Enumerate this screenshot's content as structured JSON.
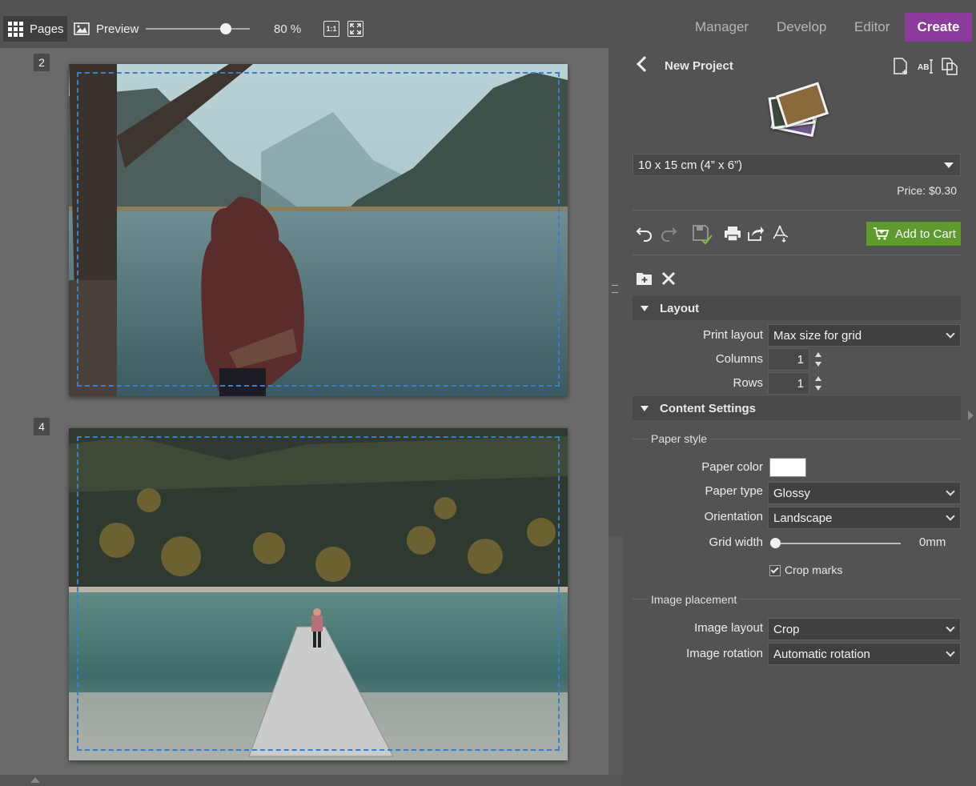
{
  "toolbar": {
    "pages_label": "Pages",
    "preview_label": "Preview",
    "zoom": "80 %",
    "zoom_fraction": 0.77,
    "actual_size_label": "1:1",
    "modes": [
      "Manager",
      "Develop",
      "Editor"
    ],
    "active_mode": "Create"
  },
  "workspace": {
    "pages": [
      {
        "number": "2"
      },
      {
        "number": "4"
      }
    ]
  },
  "panel": {
    "title": "New Project",
    "product_select": "10 x 15 cm (4” x 6”)",
    "price": "Price: $0.30",
    "add_to_cart": "Add to Cart",
    "layout": {
      "header": "Layout",
      "print_layout_label": "Print layout",
      "print_layout_value": "Max size for grid",
      "columns_label": "Columns",
      "columns_value": "1",
      "rows_label": "Rows",
      "rows_value": "1"
    },
    "content": {
      "header": "Content Settings",
      "paper_style_group": "Paper style",
      "paper_color_label": "Paper color",
      "paper_color_value": "#ffffff",
      "paper_type_label": "Paper type",
      "paper_type_value": "Glossy",
      "orientation_label": "Orientation",
      "orientation_value": "Landscape",
      "grid_width_label": "Grid width",
      "grid_width_value": "0",
      "grid_width_unit": "mm",
      "crop_marks_label": "Crop marks",
      "crop_marks_checked": true,
      "image_placement_group": "Image placement",
      "image_layout_label": "Image layout",
      "image_layout_value": "Crop",
      "image_rotation_label": "Image rotation",
      "image_rotation_value": "Automatic rotation"
    }
  },
  "colors": {
    "accent_create": "#8c3a9c",
    "add_to_cart": "#5e9a2c",
    "crop_marks": "#3a7ec8"
  }
}
